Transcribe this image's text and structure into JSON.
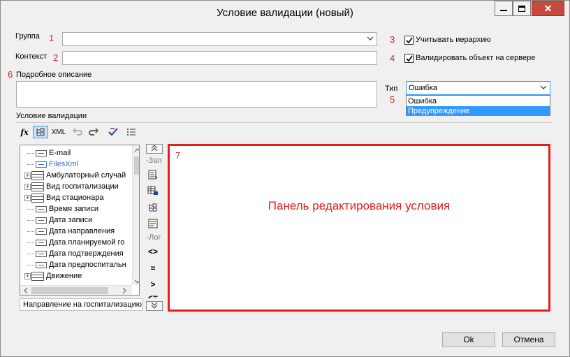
{
  "window": {
    "title": "Условие валидации (новый)",
    "close_glyph": "✕"
  },
  "form": {
    "group_label": "Группа",
    "group_value": "",
    "context_label": "Контекст",
    "context_value": "",
    "hierarchy_label": "Учитывать иерархию",
    "hierarchy_checked": true,
    "server_label": "Валидировать объект на сервере",
    "server_checked": true,
    "description_label": "Подробное описание",
    "description_value": "",
    "type_label": "Тип",
    "type_value": "Ошибка",
    "type_options": [
      "Ошибка",
      "Предупреждение"
    ],
    "type_selected_option": "Предупреждение",
    "condition_label": "Условие валидации"
  },
  "annotations": {
    "n1": "1",
    "n2": "2",
    "n3": "3",
    "n4": "4",
    "n5": "5",
    "n6": "6",
    "n7": "7"
  },
  "toolbar": {
    "fx": "fx",
    "xml": "XML",
    "icons": [
      "function-icon",
      "tree-view-icon",
      "xml-icon",
      "undo-icon",
      "redo-icon",
      "check-syntax-icon",
      "list-icon"
    ]
  },
  "tree": {
    "items": [
      {
        "label": "E-mail",
        "type": "field"
      },
      {
        "label": "FilesXml",
        "type": "field-blue"
      },
      {
        "label": "Амбулаторный случай",
        "type": "table"
      },
      {
        "label": "Вид госпитализации",
        "type": "table"
      },
      {
        "label": "Вид стационара",
        "type": "table"
      },
      {
        "label": "Время записи",
        "type": "field"
      },
      {
        "label": "Дата записи",
        "type": "field"
      },
      {
        "label": "Дата направления",
        "type": "field"
      },
      {
        "label": "Дата планируемой го",
        "type": "field"
      },
      {
        "label": "Дата подтверждения",
        "type": "field"
      },
      {
        "label": "Дата предпоспитальн",
        "type": "field"
      },
      {
        "label": "Движение",
        "type": "table"
      }
    ],
    "footer": "Направление на госпитализацию"
  },
  "side_panel": {
    "section_fields": "-Зап",
    "section_logic": "-Лог",
    "ops": [
      "<>",
      "=",
      ">",
      "<="
    ]
  },
  "editor": {
    "placeholder": "Панель редактирования условия"
  },
  "buttons": {
    "ok": "Ok",
    "cancel": "Отмена"
  },
  "colors": {
    "annotation_red": "#e02020",
    "selection_blue": "#3399ff",
    "close_red": "#c74a3f",
    "link_blue": "#3a6fd0"
  }
}
